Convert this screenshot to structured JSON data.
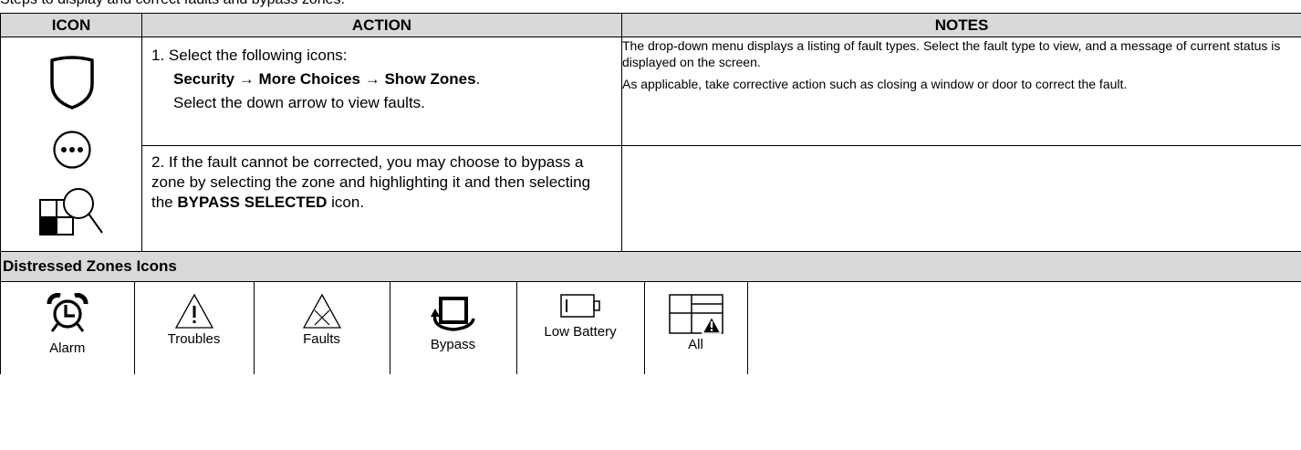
{
  "clipped_heading": "Steps to display and correct faults and bypass zones.",
  "headers": {
    "icon": "ICON",
    "action": "ACTION",
    "notes": "NOTES"
  },
  "step1": {
    "intro": "1. Select the following icons:",
    "path": "Security → More Choices → Show Zones",
    "path_end": ".",
    "hint": "Select the down arrow to view faults."
  },
  "step2": {
    "text_a": "2.  If the fault cannot be corrected, you may choose to bypass a zone by selecting the zone and highlighting it and then selecting the ",
    "bold": "BYPASS SELECTED",
    "text_b": " icon."
  },
  "notes": [
    "The drop-down menu displays a listing of fault types. Select the fault type to view, and a message of current status is displayed on the screen.",
    "As applicable, take corrective action such as closing a window or door to correct the fault."
  ],
  "section_title": "Distressed Zones Icons",
  "zones": [
    {
      "label": "Alarm",
      "icon": "alarm-clock-icon"
    },
    {
      "label": "Troubles",
      "icon": "warning-triangle-icon"
    },
    {
      "label": "Faults",
      "icon": "fault-triangle-icon"
    },
    {
      "label": "Bypass",
      "icon": "bypass-icon"
    },
    {
      "label": "Low Battery",
      "icon": "low-battery-icon"
    },
    {
      "label": "All",
      "icon": "all-zones-icon"
    }
  ],
  "icons": [
    "shield-icon",
    "more-choices-icon",
    "show-zones-icon"
  ]
}
